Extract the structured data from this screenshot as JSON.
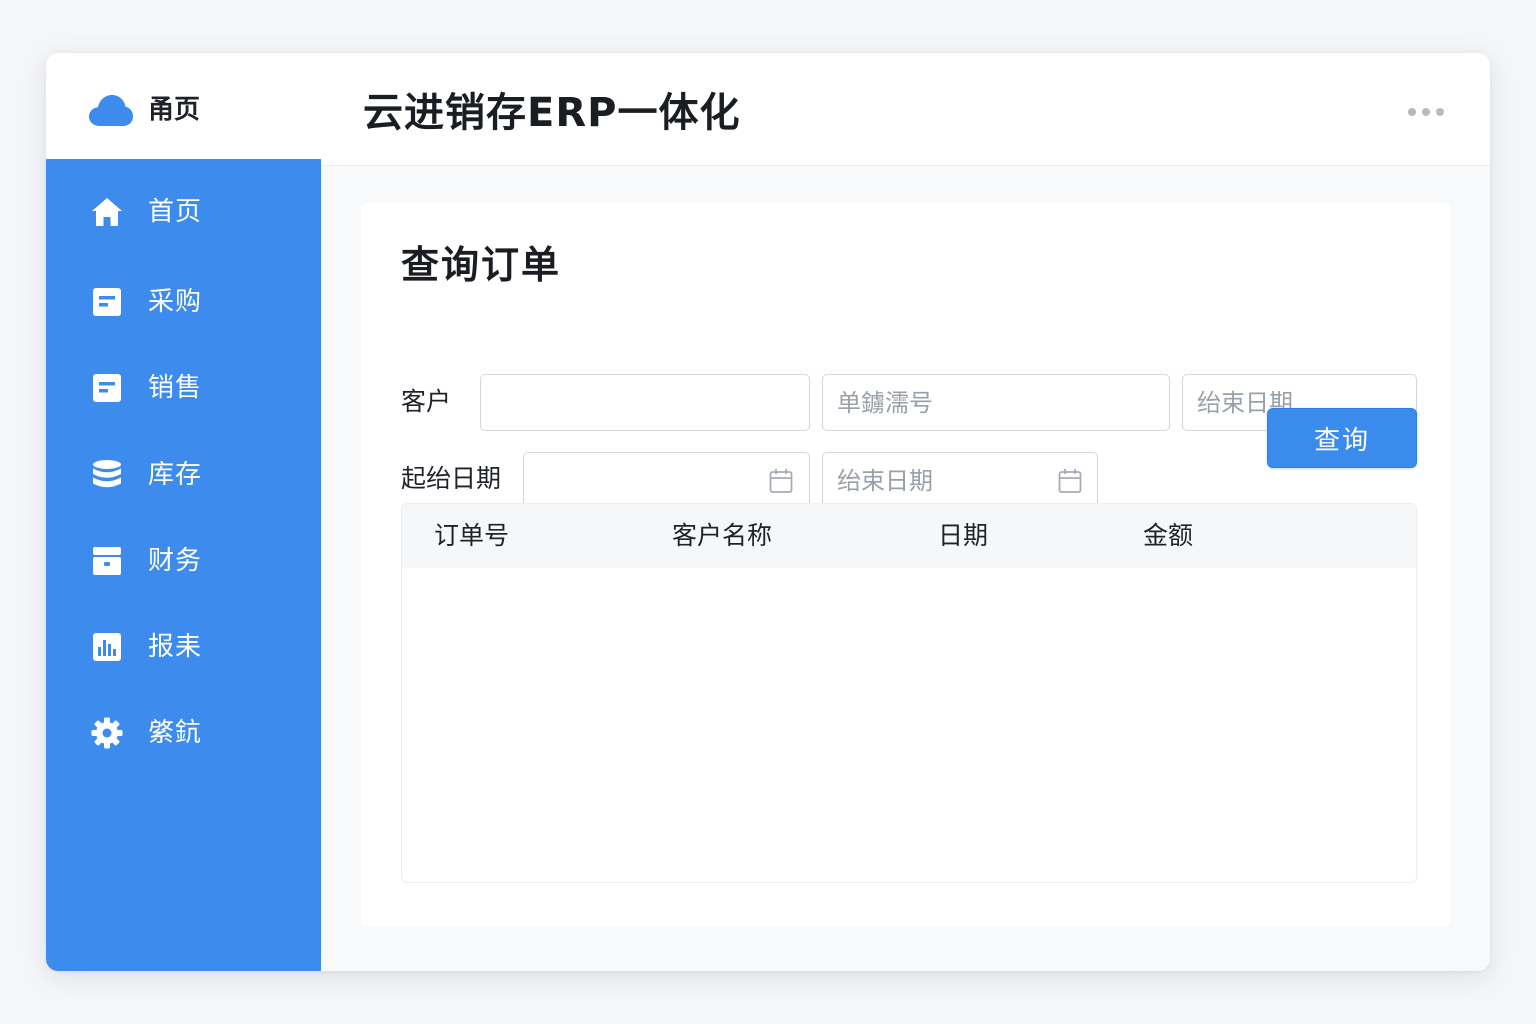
{
  "brand": {
    "label": "甬页",
    "icon": "cloud-icon"
  },
  "sidebar": {
    "items": [
      {
        "label": "首页",
        "icon": "home-icon"
      },
      {
        "label": "采购",
        "icon": "document-icon"
      },
      {
        "label": "销售",
        "icon": "document-icon"
      },
      {
        "label": "库存",
        "icon": "database-icon"
      },
      {
        "label": "财务",
        "icon": "archive-box-icon"
      },
      {
        "label": "报耒",
        "icon": "bar-chart-icon"
      },
      {
        "label": "綮鈧",
        "icon": "gear-icon"
      }
    ]
  },
  "header": {
    "title": "云进销存ERP一体化",
    "more_icon": "more-horizontal-icon"
  },
  "main": {
    "title": "查询订单",
    "filters": {
      "customer_label": "客户",
      "customer_value": "",
      "order_no_placeholder": "单鐪濡号",
      "end_date_placeholder_1": "绐束日期",
      "start_date_label": "起绐日期",
      "start_date_value": "",
      "end_date_placeholder_2": "绐束日期"
    },
    "query_button": "查询",
    "table": {
      "columns": [
        "订单号",
        "客户名称",
        "日期",
        "金额"
      ],
      "rows": []
    }
  },
  "colors": {
    "sidebar_bg": "#3d8ced",
    "accent": "#3b8bec",
    "background": "#f5f6f8"
  }
}
